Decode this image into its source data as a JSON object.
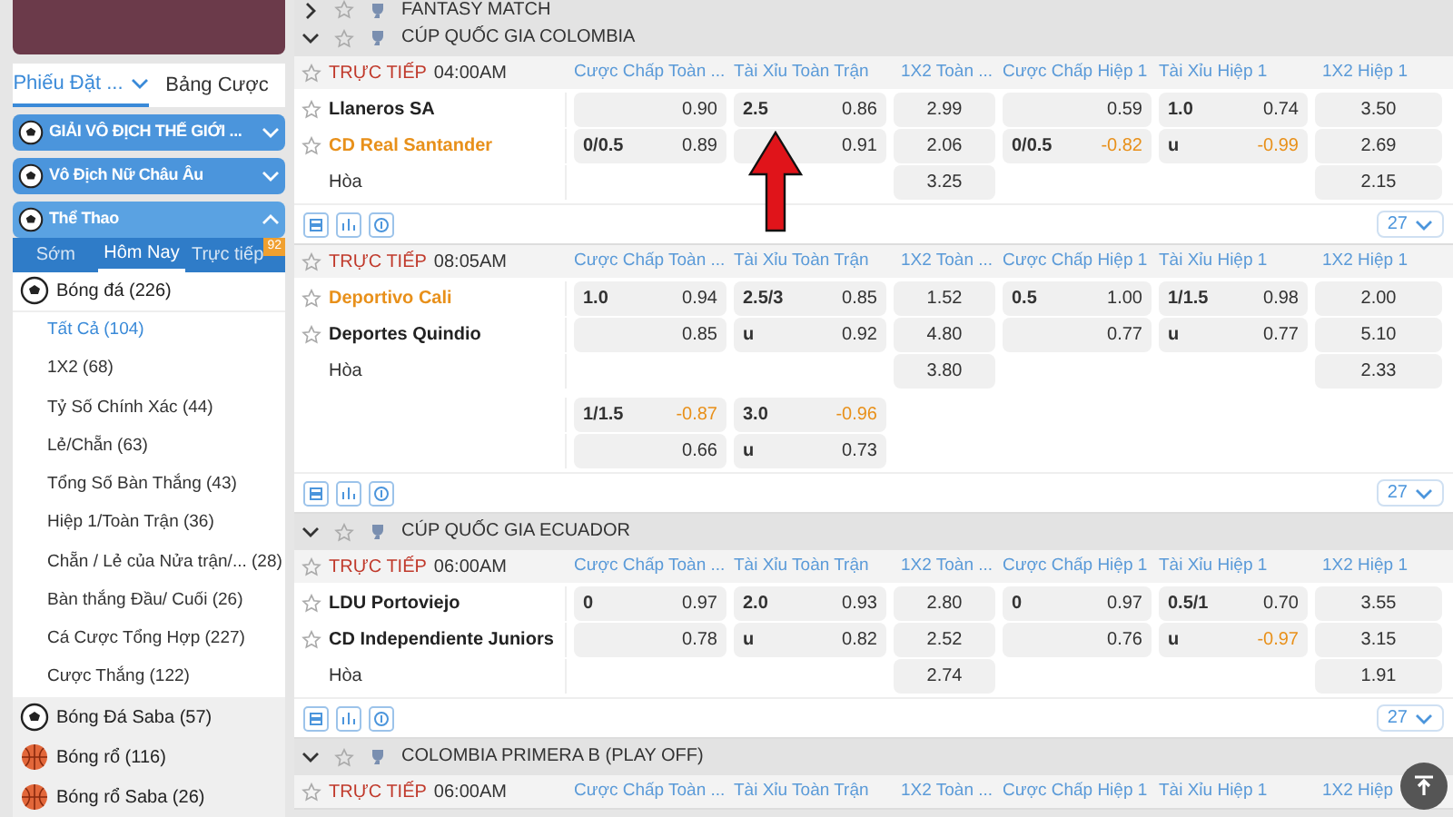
{
  "sidebar": {
    "tabs": [
      {
        "label": "Phiếu Đặt ...",
        "selected": true
      },
      {
        "label": "Bảng Cược",
        "selected": false
      }
    ],
    "banners": [
      {
        "label": "GIẢI VÔ ĐỊCH THẾ GIỚI ...",
        "expanded": false
      },
      {
        "label": "Vô Địch Nữ Châu Âu",
        "expanded": false
      },
      {
        "label": "Thể Thao",
        "expanded": true
      }
    ],
    "sport_tabs": [
      {
        "label": "Sớm",
        "selected": false
      },
      {
        "label": "Hôm Nay",
        "selected": true
      },
      {
        "label": "Trực tiếp",
        "selected": false,
        "badge": "92"
      }
    ],
    "sports": [
      {
        "label": "Bóng đá",
        "count": "(226)",
        "kind": "soccer",
        "expanded": true,
        "children": [
          {
            "label": "Tất Cả",
            "count": "(104)",
            "selected": true
          },
          {
            "label": "1X2",
            "count": "(68)",
            "selected": false
          },
          {
            "label": "Tỷ Số Chính Xác",
            "count": "(44)",
            "selected": false
          },
          {
            "label": "Lẻ/Chẵn",
            "count": "(63)",
            "selected": false
          },
          {
            "label": "Tổng Số Bàn Thắng",
            "count": "(43)",
            "selected": false
          },
          {
            "label": "Hiệp 1/Toàn Trận",
            "count": "(36)",
            "selected": false
          },
          {
            "label": "Chẵn / Lẻ của Nửa trận/...",
            "count": "(28)",
            "selected": false
          },
          {
            "label": "Bàn thắng Đầu/ Cuối",
            "count": "(26)",
            "selected": false
          },
          {
            "label": "Cá Cược Tổng Hợp",
            "count": "(227)",
            "selected": false
          },
          {
            "label": "Cược Thắng",
            "count": "(122)",
            "selected": false
          }
        ]
      },
      {
        "label": "Bóng Đá Saba",
        "count": "(57)",
        "kind": "soccer",
        "expanded": false
      },
      {
        "label": "Bóng rổ",
        "count": "(116)",
        "kind": "basketball",
        "expanded": false
      },
      {
        "label": "Bóng rổ Saba",
        "count": "(26)",
        "kind": "basketball",
        "expanded": false
      }
    ]
  },
  "leagues": [
    {
      "name": "FANTASY MATCH",
      "expanded": false
    },
    {
      "name": "CÚP QUỐC GIA COLOMBIA",
      "expanded": true,
      "matches": [
        {
          "status": "TRỰC TIẾP",
          "time": "04:00AM",
          "count": "27",
          "columns": [
            {
              "label": "Cược Chấp Toàn ...",
              "kind": "pair"
            },
            {
              "label": "Tài Xỉu Toàn Trận",
              "kind": "pair"
            },
            {
              "label": "1X2 Toàn ...",
              "kind": "single"
            },
            {
              "label": "Cược Chấp Hiệp 1",
              "kind": "pair"
            },
            {
              "label": "Tài Xỉu Hiệp 1",
              "kind": "pair"
            },
            {
              "label": "1X2 Hiệp 1",
              "kind": "single"
            }
          ],
          "rows": [
            {
              "kind": "team",
              "team": "Llaneros SA",
              "highlighted": false,
              "cells": [
                {
                  "odds": "0.90",
                  "highlighted": false
                },
                {
                  "line": "2.5",
                  "odds": "0.86",
                  "highlighted": false
                },
                {
                  "odds": "2.99",
                  "highlighted": false
                },
                {
                  "odds": "0.59",
                  "highlighted": false
                },
                {
                  "line": "1.0",
                  "odds": "0.74",
                  "highlighted": false
                },
                {
                  "odds": "3.50",
                  "highlighted": false
                }
              ]
            },
            {
              "kind": "team",
              "team": "CD Real Santander",
              "highlighted": true,
              "cells": [
                {
                  "line": "0/0.5",
                  "odds": "0.89",
                  "highlighted": false
                },
                {
                  "odds": "0.91",
                  "highlighted": false
                },
                {
                  "odds": "2.06",
                  "highlighted": false
                },
                {
                  "line": "0/0.5",
                  "odds": "-0.82",
                  "highlighted": true
                },
                {
                  "line": "u",
                  "odds": "-0.99",
                  "highlighted": true
                },
                {
                  "odds": "2.69",
                  "highlighted": false
                }
              ]
            },
            {
              "kind": "draw",
              "team": "Hòa",
              "cells": [
                null,
                null,
                {
                  "odds": "3.25",
                  "highlighted": false
                },
                null,
                null,
                {
                  "odds": "2.15",
                  "highlighted": false
                }
              ]
            }
          ]
        },
        {
          "status": "TRỰC TIẾP",
          "time": "08:05AM",
          "count": "27",
          "columns": [
            {
              "label": "Cược Chấp Toàn ...",
              "kind": "pair"
            },
            {
              "label": "Tài Xỉu Toàn Trận",
              "kind": "pair"
            },
            {
              "label": "1X2 Toàn ...",
              "kind": "single"
            },
            {
              "label": "Cược Chấp Hiệp 1",
              "kind": "pair"
            },
            {
              "label": "Tài Xỉu Hiệp 1",
              "kind": "pair"
            },
            {
              "label": "1X2 Hiệp 1",
              "kind": "single"
            }
          ],
          "rows": [
            {
              "kind": "team",
              "team": "Deportivo Cali",
              "highlighted": true,
              "cells": [
                {
                  "line": "1.0",
                  "odds": "0.94",
                  "highlighted": false
                },
                {
                  "line": "2.5/3",
                  "odds": "0.85",
                  "highlighted": false
                },
                {
                  "odds": "1.52",
                  "highlighted": false
                },
                {
                  "line": "0.5",
                  "odds": "1.00",
                  "highlighted": false
                },
                {
                  "line": "1/1.5",
                  "odds": "0.98",
                  "highlighted": false
                },
                {
                  "odds": "2.00",
                  "highlighted": false
                }
              ]
            },
            {
              "kind": "team",
              "team": "Deportes Quindio",
              "highlighted": false,
              "cells": [
                {
                  "odds": "0.85",
                  "highlighted": false
                },
                {
                  "line": "u",
                  "odds": "0.92",
                  "highlighted": false
                },
                {
                  "odds": "4.80",
                  "highlighted": false
                },
                {
                  "odds": "0.77",
                  "highlighted": false
                },
                {
                  "line": "u",
                  "odds": "0.77",
                  "highlighted": false
                },
                {
                  "odds": "5.10",
                  "highlighted": false
                }
              ]
            },
            {
              "kind": "draw",
              "team": "Hòa",
              "cells": [
                null,
                null,
                {
                  "odds": "3.80",
                  "highlighted": false
                },
                null,
                null,
                {
                  "odds": "2.33",
                  "highlighted": false
                }
              ]
            },
            {
              "kind": "extra",
              "cells": [
                {
                  "line": "1/1.5",
                  "odds": "-0.87",
                  "highlighted": true
                },
                {
                  "line": "3.0",
                  "odds": "-0.96",
                  "highlighted": true
                },
                null,
                null,
                null,
                null
              ]
            },
            {
              "kind": "extra",
              "cells": [
                {
                  "odds": "0.66",
                  "highlighted": false
                },
                {
                  "line": "u",
                  "odds": "0.73",
                  "highlighted": false
                },
                null,
                null,
                null,
                null
              ]
            }
          ]
        }
      ]
    },
    {
      "name": "CÚP QUỐC GIA ECUADOR",
      "expanded": true,
      "matches": [
        {
          "status": "TRỰC TIẾP",
          "time": "06:00AM",
          "count": "27",
          "columns": [
            {
              "label": "Cược Chấp Toàn ...",
              "kind": "pair"
            },
            {
              "label": "Tài Xỉu Toàn Trận",
              "kind": "pair"
            },
            {
              "label": "1X2 Toàn ...",
              "kind": "single"
            },
            {
              "label": "Cược Chấp Hiệp 1",
              "kind": "pair"
            },
            {
              "label": "Tài Xỉu Hiệp 1",
              "kind": "pair"
            },
            {
              "label": "1X2 Hiệp 1",
              "kind": "single"
            }
          ],
          "rows": [
            {
              "kind": "team",
              "team": "LDU Portoviejo",
              "highlighted": false,
              "cells": [
                {
                  "line": "0",
                  "odds": "0.97",
                  "highlighted": false
                },
                {
                  "line": "2.0",
                  "odds": "0.93",
                  "highlighted": false
                },
                {
                  "odds": "2.80",
                  "highlighted": false
                },
                {
                  "line": "0",
                  "odds": "0.97",
                  "highlighted": false
                },
                {
                  "line": "0.5/1",
                  "odds": "0.70",
                  "highlighted": false
                },
                {
                  "odds": "3.55",
                  "highlighted": false
                }
              ]
            },
            {
              "kind": "team",
              "team": "CD Independiente Juniors",
              "highlighted": false,
              "cells": [
                {
                  "odds": "0.78",
                  "highlighted": false
                },
                {
                  "line": "u",
                  "odds": "0.82",
                  "highlighted": false
                },
                {
                  "odds": "2.52",
                  "highlighted": false
                },
                {
                  "odds": "0.76",
                  "highlighted": false
                },
                {
                  "line": "u",
                  "odds": "-0.97",
                  "highlighted": true
                },
                {
                  "odds": "3.15",
                  "highlighted": false
                }
              ]
            },
            {
              "kind": "draw",
              "team": "Hòa",
              "cells": [
                null,
                null,
                {
                  "odds": "2.74",
                  "highlighted": false
                },
                null,
                null,
                {
                  "odds": "1.91",
                  "highlighted": false
                }
              ]
            }
          ]
        }
      ]
    },
    {
      "name": "COLOMBIA PRIMERA B (PLAY OFF)",
      "expanded": true,
      "matches": [
        {
          "status": "TRỰC TIẾP",
          "time": "06:00AM",
          "columns": [
            {
              "label": "Cược Chấp Toàn ...",
              "kind": "pair"
            },
            {
              "label": "Tài Xỉu Toàn Trận",
              "kind": "pair"
            },
            {
              "label": "1X2 Toàn ...",
              "kind": "single"
            },
            {
              "label": "Cược Chấp Hiệp 1",
              "kind": "pair"
            },
            {
              "label": "Tài Xỉu Hiệp 1",
              "kind": "pair"
            },
            {
              "label": "1X2 Hiệp",
              "kind": "single"
            }
          ]
        }
      ]
    }
  ]
}
